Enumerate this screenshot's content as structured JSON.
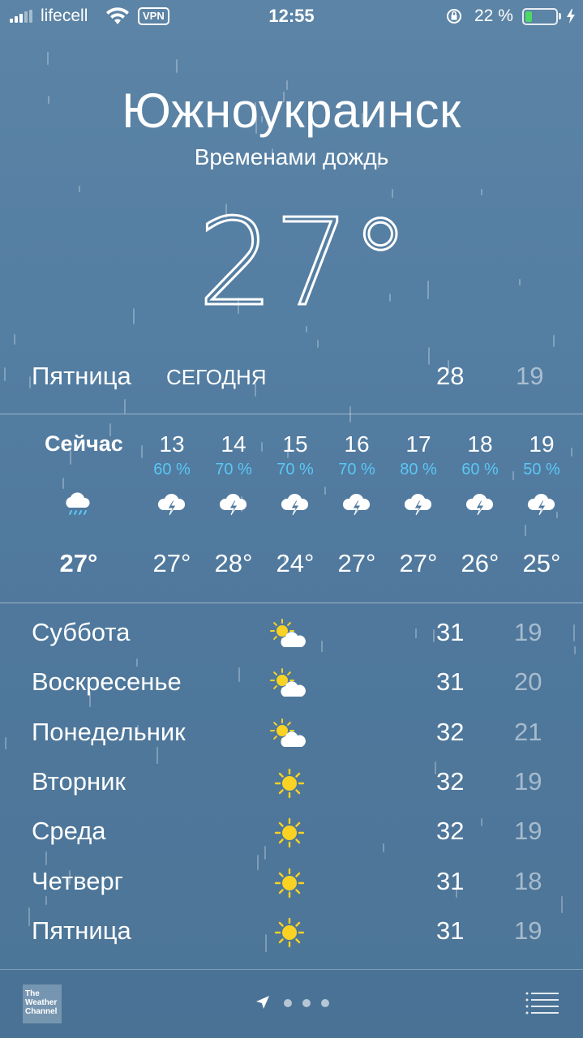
{
  "status_bar": {
    "carrier": "lifecell",
    "vpn": "VPN",
    "time": "12:55",
    "battery_pct": "22 %",
    "battery_level": 0.22,
    "battery_color": "#4cd964"
  },
  "header": {
    "city": "Южноукраинск",
    "condition": "Временами дождь",
    "temperature": "27°"
  },
  "today": {
    "day": "Пятница",
    "label": "СЕГОДНЯ",
    "high": "28",
    "low": "19"
  },
  "hourly": [
    {
      "time": "Сейчас",
      "pop": "",
      "icon": "rain-icon",
      "temp": "27°"
    },
    {
      "time": "13",
      "pop": "60 %",
      "icon": "thunderstorm-icon",
      "temp": "27°"
    },
    {
      "time": "14",
      "pop": "70 %",
      "icon": "thunderstorm-icon",
      "temp": "28°"
    },
    {
      "time": "15",
      "pop": "70 %",
      "icon": "thunderstorm-icon",
      "temp": "24°"
    },
    {
      "time": "16",
      "pop": "70 %",
      "icon": "thunderstorm-icon",
      "temp": "27°"
    },
    {
      "time": "17",
      "pop": "80 %",
      "icon": "thunderstorm-icon",
      "temp": "27°"
    },
    {
      "time": "18",
      "pop": "60 %",
      "icon": "thunderstorm-icon",
      "temp": "26°"
    },
    {
      "time": "19",
      "pop": "50 %",
      "icon": "thunderstorm-icon",
      "temp": "25°"
    }
  ],
  "daily": [
    {
      "day": "Суббота",
      "icon": "partly-sunny-icon",
      "high": "31",
      "low": "19"
    },
    {
      "day": "Воскресенье",
      "icon": "partly-sunny-icon",
      "high": "31",
      "low": "20"
    },
    {
      "day": "Понедельник",
      "icon": "partly-sunny-icon",
      "high": "32",
      "low": "21"
    },
    {
      "day": "Вторник",
      "icon": "sunny-icon",
      "high": "32",
      "low": "19"
    },
    {
      "day": "Среда",
      "icon": "sunny-icon",
      "high": "32",
      "low": "19"
    },
    {
      "day": "Четверг",
      "icon": "sunny-icon",
      "high": "31",
      "low": "18"
    },
    {
      "day": "Пятница",
      "icon": "sunny-icon",
      "high": "31",
      "low": "19"
    }
  ],
  "footer": {
    "twc_logo_text": "The Weather Channel",
    "page_count": 3
  },
  "colors": {
    "pop": "#5bc7f5",
    "sun": "#f9d223"
  }
}
